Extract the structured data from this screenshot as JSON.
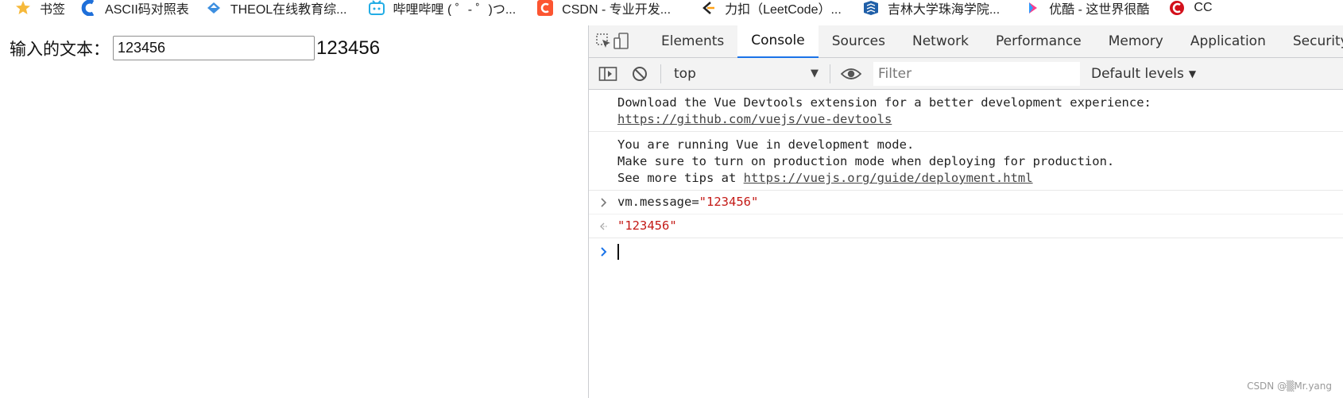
{
  "bookmarks": [
    {
      "label": "书签",
      "icon": "star-icon"
    },
    {
      "label": "ASCII码对照表",
      "icon": "c-logo-icon"
    },
    {
      "label": "THEOL在线教育综...",
      "icon": "theol-icon"
    },
    {
      "label": "哔哩哔哩 ( ゜- ゜)つ...",
      "icon": "bilibili-icon"
    },
    {
      "label": "CSDN - 专业开发...",
      "icon": "csdn-icon"
    },
    {
      "label": "力扣（LeetCode）...",
      "icon": "leetcode-icon"
    },
    {
      "label": "吉林大学珠海学院...",
      "icon": "jlu-icon"
    },
    {
      "label": "优酷 - 这世界很酷",
      "icon": "youku-icon"
    },
    {
      "label": "CC",
      "icon": "cc-icon"
    }
  ],
  "page": {
    "label": "输入的文本：",
    "input_value": "123456",
    "echo": "123456"
  },
  "devtools": {
    "tabs": [
      "Elements",
      "Console",
      "Sources",
      "Network",
      "Performance",
      "Memory",
      "Application",
      "Security"
    ],
    "active_tab": "Console",
    "context": "top",
    "filter_placeholder": "Filter",
    "levels": "Default levels"
  },
  "console": {
    "msg1_text": "Download the Vue Devtools extension for a better development experience:",
    "msg1_link": "https://github.com/vuejs/vue-devtools",
    "msg2_line1": "You are running Vue in development mode.",
    "msg2_line2": "Make sure to turn on production mode when deploying for production.",
    "msg2_line3_prefix": "See more tips at ",
    "msg2_link": "https://vuejs.org/guide/deployment.html",
    "input_cmd": "vm.message=",
    "input_str": "\"123456\"",
    "result_str": "\"123456\""
  },
  "watermark": "CSDN @▒Mr.yang",
  "colors": {
    "accent": "#1a73e8",
    "string": "#c41a16"
  }
}
